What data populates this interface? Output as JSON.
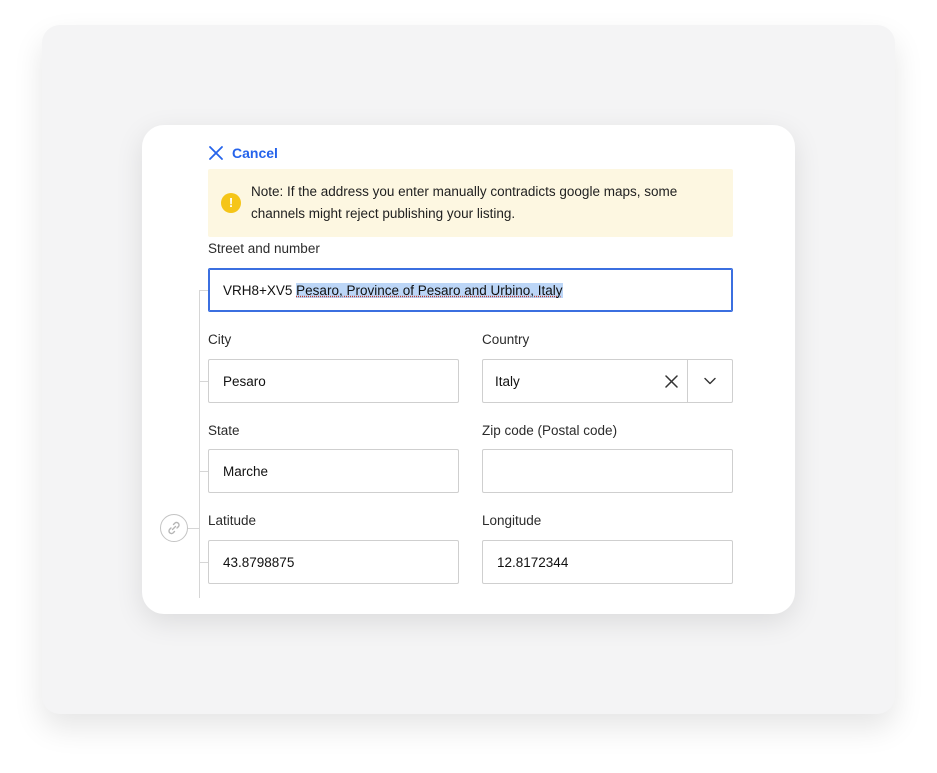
{
  "cancel": {
    "label": "Cancel",
    "icon": "close-icon"
  },
  "notice": {
    "text": "Note: If the address you enter manually contradicts google maps, some channels might reject publishing your listing.",
    "icon": "exclamation-icon"
  },
  "street": {
    "label": "Street and number",
    "value_plain": "VRH8+XV5 ",
    "value_selected": "Pesaro, Province of Pesaro and Urbino, Italy"
  },
  "city": {
    "label": "City",
    "value": "Pesaro"
  },
  "country": {
    "label": "Country",
    "value": "Italy"
  },
  "state": {
    "label": "State",
    "value": "Marche"
  },
  "zip": {
    "label": "Zip code (Postal code)",
    "value": ""
  },
  "latitude": {
    "label": "Latitude",
    "value": "43.8798875"
  },
  "longitude": {
    "label": "Longitude",
    "value": "12.8172344"
  },
  "colors": {
    "accent": "#2563eb",
    "warning": "#f5c518",
    "notice_bg": "#fdf7e1"
  }
}
